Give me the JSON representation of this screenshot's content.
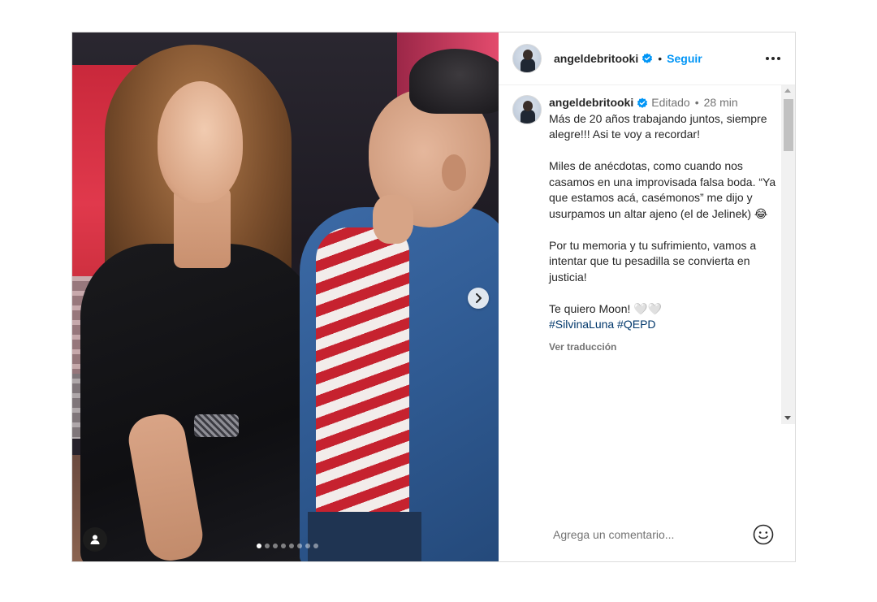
{
  "post": {
    "author": {
      "username": "angeldebritooki",
      "verified": true,
      "follow_label": "Seguir",
      "separator": "•"
    },
    "media": {
      "image_description_icon": "user-tag-icon",
      "next_icon": "chevron-right-icon",
      "carousel": {
        "total": 8,
        "current": 1
      }
    },
    "caption": {
      "edited_label": "Editado",
      "separator": "•",
      "time": "28 min",
      "paragraphs": [
        "Más de 20 años trabajando juntos, siempre alegre!!! Asi te voy a recordar!",
        "Miles de anécdotas, como cuando nos casamos en una improvisada falsa boda. “Ya que estamos acá, casémonos” me dijo y usurpamos un altar ajeno (el de Jelinek) 😂",
        "Por tu memoria y tu sufrimiento, vamos a intentar que tu pesadilla se convierta en justicia!"
      ],
      "closing": "Te quiero Moon! 🤍🤍",
      "hashtags": "#SilvinaLuna #QEPD",
      "translate_label": "Ver traducción"
    },
    "comment": {
      "placeholder": "Agrega un comentario...",
      "emoji_icon": "smiley-icon"
    }
  },
  "colors": {
    "accent": "#0095f6",
    "hashtag": "#00376b",
    "muted": "#737373",
    "border": "#dbdbdb"
  }
}
